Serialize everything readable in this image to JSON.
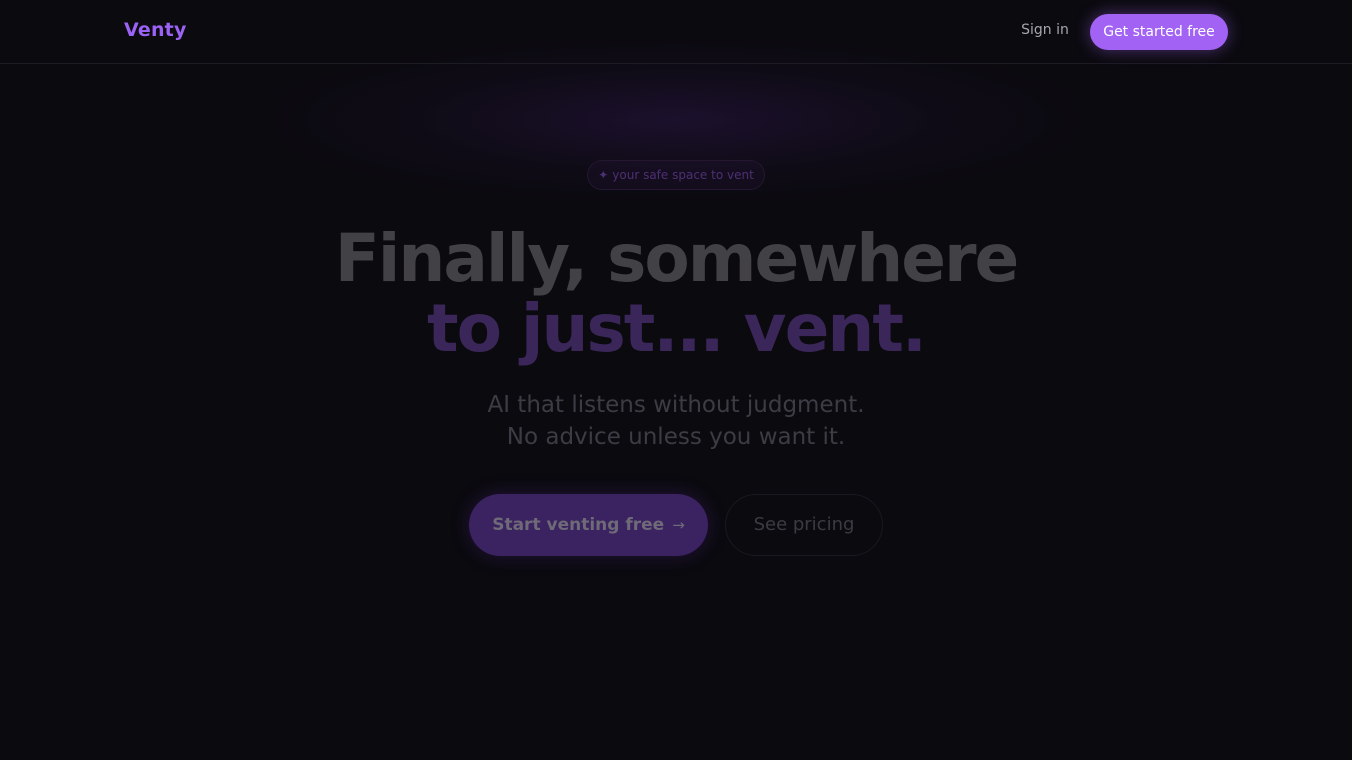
{
  "nav": {
    "logo": "Venty",
    "signin_label": "Sign in",
    "cta_label": "Get started free"
  },
  "hero": {
    "badge_icon": "sparkle-icon",
    "badge_label": "your safe space to vent",
    "headline_line1": "Finally, somewhere",
    "headline_line2": "to just... vent.",
    "subtitle_line1": "AI that listens without judgment.",
    "subtitle_line2": "No advice unless you want it.",
    "primary_button": "Start venting free",
    "primary_button_icon": "arrow-right-icon",
    "secondary_button": "See pricing"
  },
  "colors": {
    "background": "#0b0a0f",
    "accent": "#a263f5",
    "logo": "#9b62f5"
  }
}
